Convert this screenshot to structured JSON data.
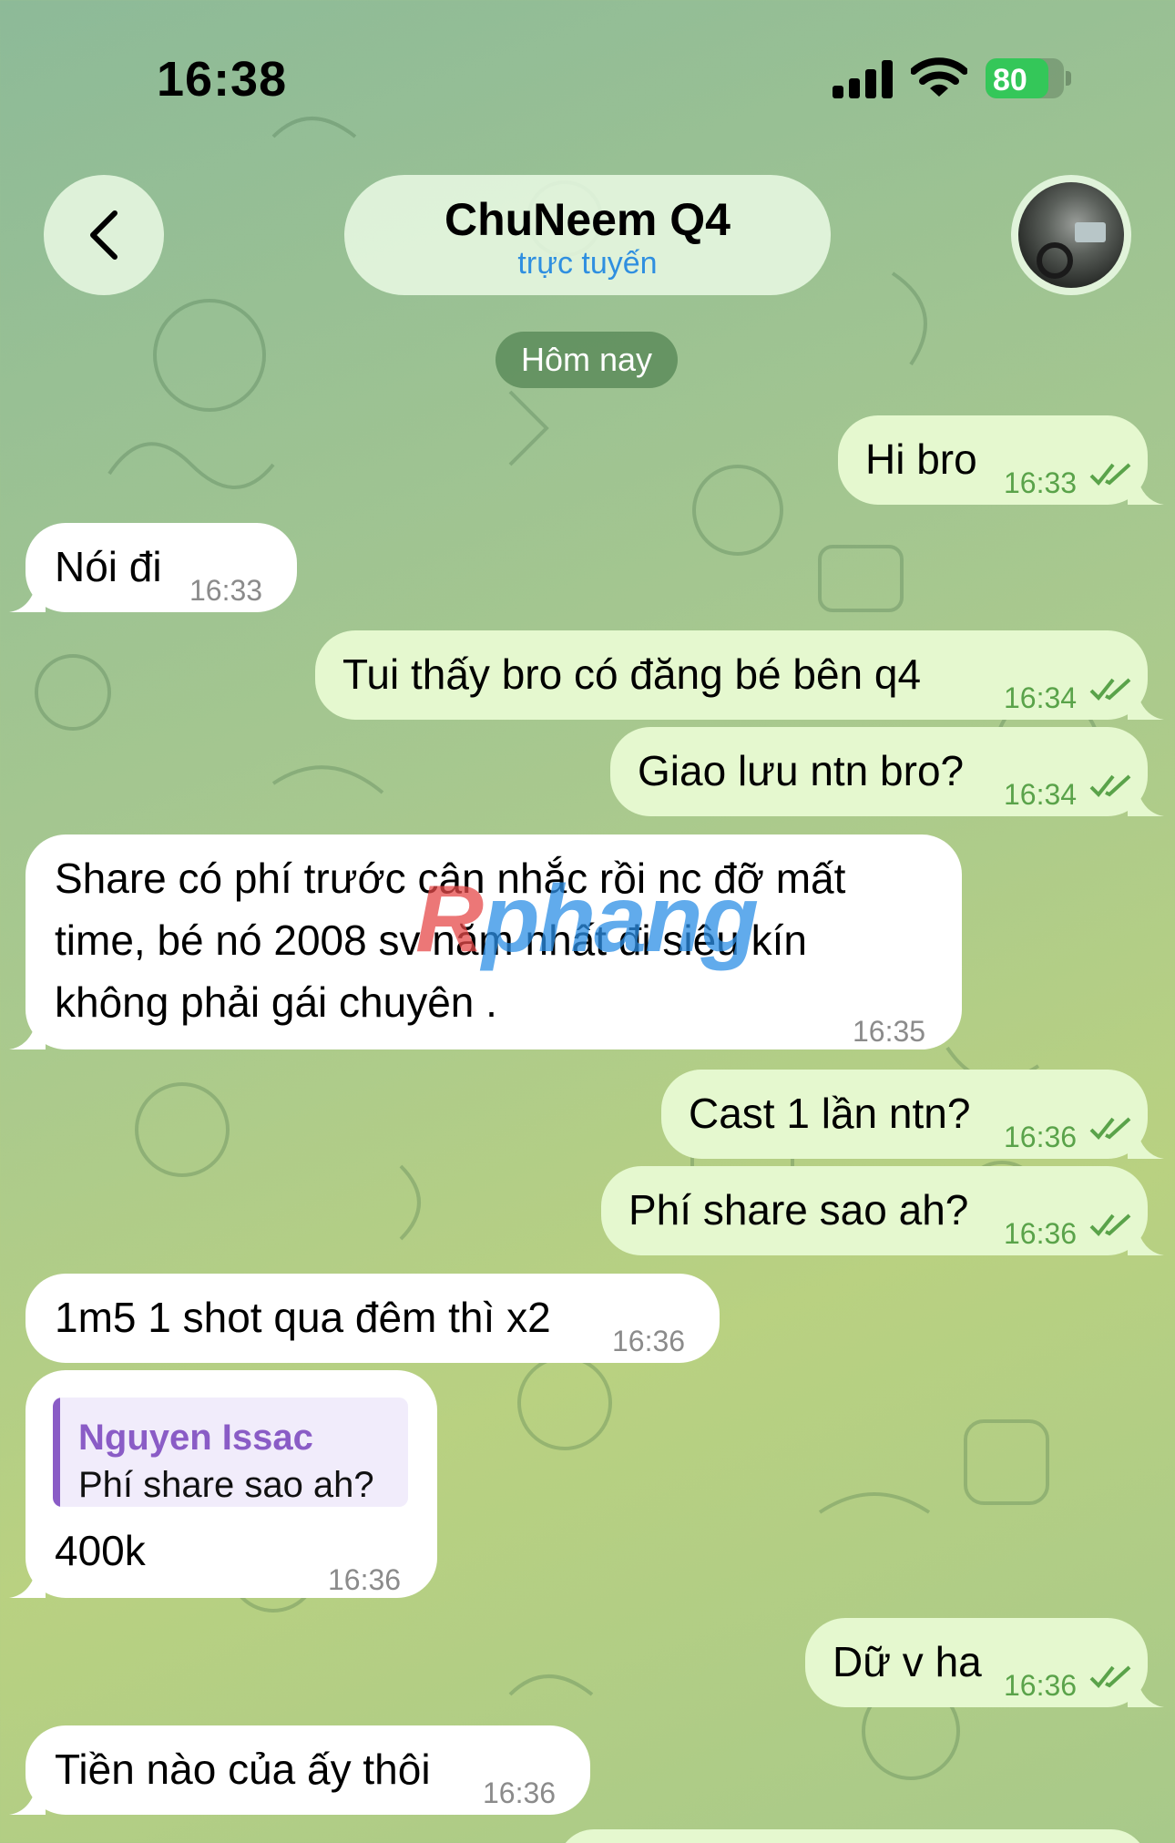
{
  "status_bar": {
    "time": "16:38",
    "battery": "80",
    "battery_level": 0.8,
    "icons": [
      "signal-icon",
      "wifi-icon",
      "battery-charging-icon"
    ]
  },
  "header": {
    "back_icon": "chevron-left-icon",
    "title": "ChuNeem Q4",
    "status": "trực tuyến",
    "status_color": "#2f8fe0"
  },
  "date_badge": "Hôm nay",
  "messages": [
    {
      "direction": "out",
      "text": "Hi bro",
      "time": "16:33",
      "read": true
    },
    {
      "direction": "in",
      "text": "Nói đi",
      "time": "16:33"
    },
    {
      "direction": "out",
      "text": "Tui thấy bro có đăng bé bên q4",
      "time": "16:34",
      "read": true
    },
    {
      "direction": "out",
      "text": "Giao lưu ntn bro?",
      "time": "16:34",
      "read": true
    },
    {
      "direction": "in",
      "lines": [
        "Share có phí trước cân nhắc rồi nc đỡ mất",
        "time, bé nó 2008 sv năm nhất đi siêu kín",
        "không phải gái chuyên ."
      ],
      "time": "16:35"
    },
    {
      "direction": "out",
      "text": "Cast 1 lần ntn?",
      "time": "16:36",
      "read": true
    },
    {
      "direction": "out",
      "text": "Phí share sao ah?",
      "time": "16:36",
      "read": true
    },
    {
      "direction": "in",
      "text": "1m5 1 shot qua đêm thì x2",
      "time": "16:36"
    },
    {
      "direction": "in",
      "reply_to": {
        "name": "Nguyen Issac",
        "text": "Phí share sao ah?"
      },
      "text": "400k",
      "time": "16:36"
    },
    {
      "direction": "out",
      "text": "Dữ v ha",
      "time": "16:36",
      "read": true
    },
    {
      "direction": "in",
      "text": "Tiền nào của ấy thôi",
      "time": "16:36"
    }
  ],
  "watermark": {
    "first": "R",
    "rest": "phang"
  },
  "colors": {
    "outgoing_bubble": "#e5f8cf",
    "incoming_bubble": "#ffffff",
    "outgoing_time": "#5aa34a",
    "reply_accent": "#8a5cc6"
  }
}
